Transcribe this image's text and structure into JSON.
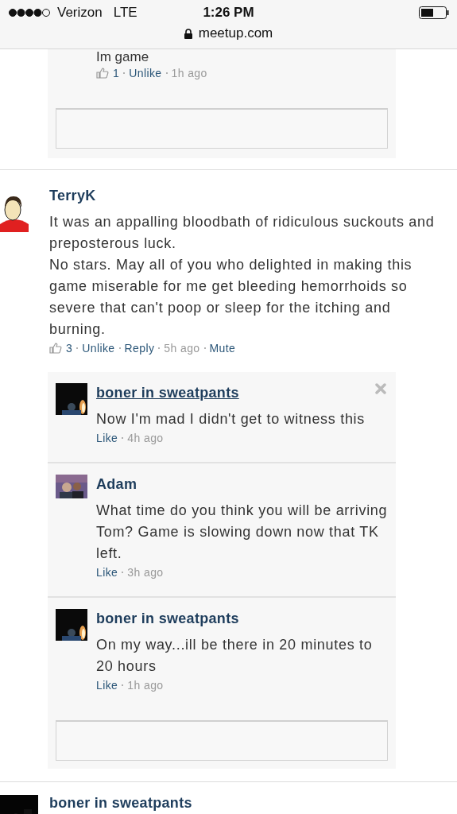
{
  "status_bar": {
    "carrier": "Verizon",
    "network": "LTE",
    "time": "1:26 PM"
  },
  "address_bar": {
    "url": "meetup.com"
  },
  "top_thread": {
    "replies": [
      {
        "text": "Im game",
        "meta": [
          {
            "kind": "likes",
            "text": "1"
          },
          {
            "kind": "link",
            "text": "Unlike"
          },
          {
            "kind": "time",
            "text": "1h ago"
          }
        ]
      }
    ]
  },
  "comments": [
    {
      "author": "TerryK",
      "text": "It was an appalling bloodbath of ridiculous suckouts and preposterous luck.\nNo stars. May all of you who delighted in making this game miserable for me get bleeding hemorrhoids so severe that can't poop or sleep for the itching and burning.",
      "meta": [
        {
          "kind": "likes",
          "text": "3"
        },
        {
          "kind": "link",
          "text": "Unlike"
        },
        {
          "kind": "link",
          "text": "Reply"
        },
        {
          "kind": "time",
          "text": "5h ago"
        },
        {
          "kind": "link",
          "text": "Mute"
        }
      ],
      "replies": [
        {
          "author": "boner in sweatpants",
          "underlined": true,
          "closable": true,
          "text": "Now I'm mad I didn't get to witness this",
          "meta": [
            {
              "kind": "link",
              "text": "Like"
            },
            {
              "kind": "time",
              "text": "4h ago"
            }
          ]
        },
        {
          "author": "Adam",
          "underlined": false,
          "closable": false,
          "text": "What time do you think you will be arriving Tom? Game is slowing down now that TK left.",
          "meta": [
            {
              "kind": "link",
              "text": "Like"
            },
            {
              "kind": "time",
              "text": "3h ago"
            }
          ]
        },
        {
          "author": "boner in sweatpants",
          "underlined": false,
          "closable": false,
          "text": "On my way...ill be there in 20 minutes to 20 hours",
          "meta": [
            {
              "kind": "link",
              "text": "Like"
            },
            {
              "kind": "time",
              "text": "1h ago"
            }
          ]
        }
      ]
    },
    {
      "author": "boner in sweatpants"
    }
  ]
}
